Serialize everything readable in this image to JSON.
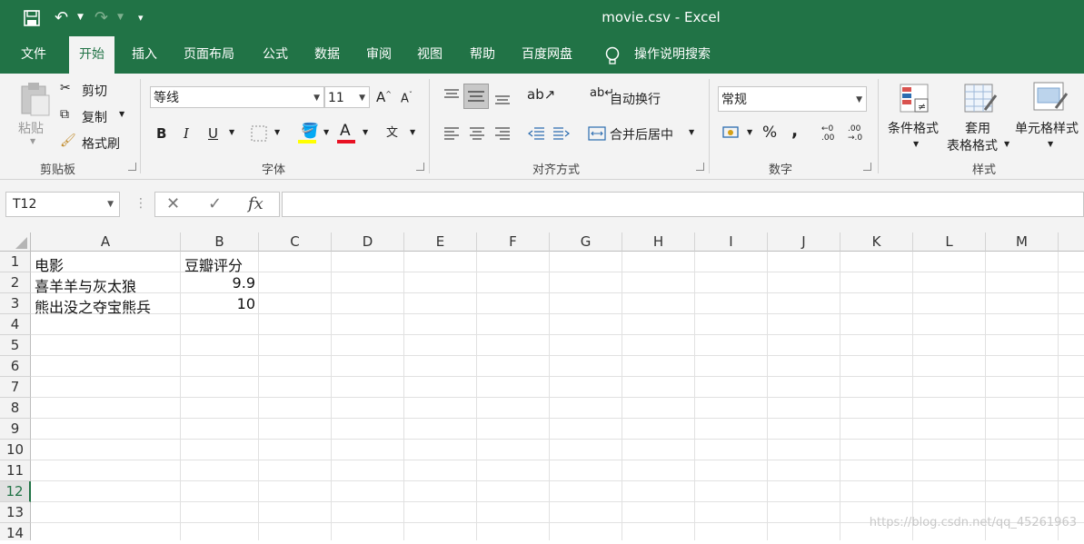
{
  "window": {
    "title": "movie.csv  -  Excel"
  },
  "quick_access": {
    "save_icon": "save-icon",
    "undo_icon": "undo-icon",
    "redo_icon": "redo-icon",
    "customize_icon": "customize-icon"
  },
  "tabs": [
    {
      "label": "文件"
    },
    {
      "label": "开始",
      "active": true
    },
    {
      "label": "插入"
    },
    {
      "label": "页面布局"
    },
    {
      "label": "公式"
    },
    {
      "label": "数据"
    },
    {
      "label": "审阅"
    },
    {
      "label": "视图"
    },
    {
      "label": "帮助"
    },
    {
      "label": "百度网盘"
    }
  ],
  "tell_me": "操作说明搜索",
  "ribbon": {
    "clipboard": {
      "label": "剪贴板",
      "paste": "粘贴",
      "cut": "剪切",
      "copy": "复制",
      "format_painter": "格式刷"
    },
    "font": {
      "label": "字体",
      "font_name": "等线",
      "font_size": "11",
      "bold": "B",
      "italic": "I",
      "underline": "U"
    },
    "alignment": {
      "label": "对齐方式",
      "wrap_text": "自动换行",
      "merge_center": "合并后居中"
    },
    "number": {
      "label": "数字",
      "format": "常规",
      "percent": "%",
      "comma": ","
    },
    "styles": {
      "label": "样式",
      "conditional": "条件格式",
      "table1": "套用",
      "table2": "表格格式",
      "cell_styles": "单元格样式"
    }
  },
  "formula_bar": {
    "name_box": "T12",
    "fx": "fx",
    "formula": ""
  },
  "columns": [
    "A",
    "B",
    "C",
    "D",
    "E",
    "F",
    "G",
    "H",
    "I",
    "J",
    "K",
    "L",
    "M"
  ],
  "rows": [
    "1",
    "2",
    "3",
    "4",
    "5",
    "6",
    "7",
    "8",
    "9",
    "10",
    "11",
    "12",
    "13",
    "14"
  ],
  "cells": {
    "A1": "电影",
    "B1": "豆瓣评分",
    "A2": "喜羊羊与灰太狼",
    "B2": "9.9",
    "A3": "熊出没之夺宝熊兵",
    "B3": "10"
  },
  "watermark": "https://blog.csdn.net/qq_45261963",
  "colors": {
    "accent": "#217346"
  }
}
